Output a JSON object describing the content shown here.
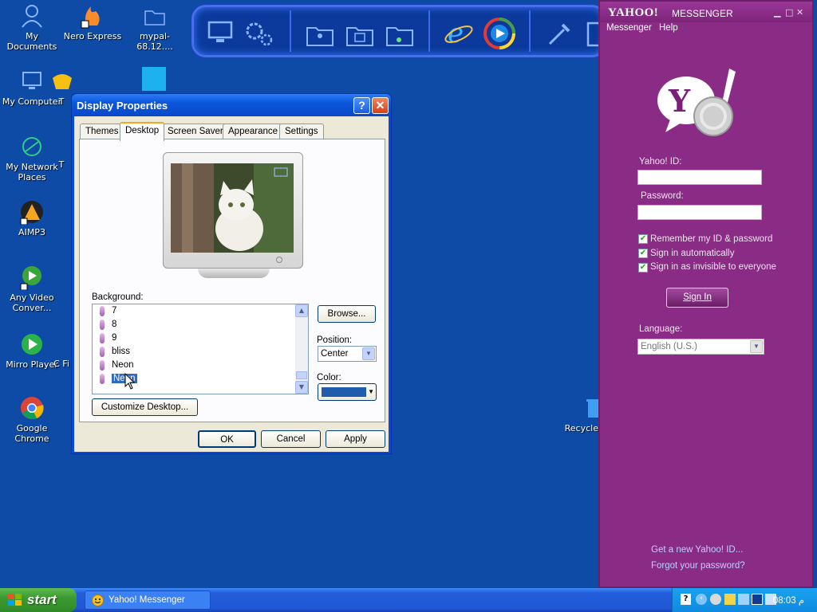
{
  "desktop": {
    "icons": [
      {
        "label": "My Documents"
      },
      {
        "label": "Nero Express"
      },
      {
        "label": "mypal-68.12...."
      },
      {
        "label": "My Computer"
      },
      {
        "label": "T"
      },
      {
        "label": "My Network Places"
      },
      {
        "label": "T"
      },
      {
        "label": "AIMP3"
      },
      {
        "label": "Any Video Conver..."
      },
      {
        "label": "Mirro Player"
      },
      {
        "label": "C Fi"
      },
      {
        "label": "Google Chrome"
      },
      {
        "label": "Recycle"
      }
    ]
  },
  "display_properties": {
    "title": "Display Properties",
    "help_btn": "?",
    "close_btn": "✕",
    "tabs": [
      {
        "label": "Themes"
      },
      {
        "label": "Desktop"
      },
      {
        "label": "Screen Saver"
      },
      {
        "label": "Appearance"
      },
      {
        "label": "Settings"
      }
    ],
    "active_tab": "Desktop",
    "background_label": "Background:",
    "background_items": [
      "7",
      "8",
      "9",
      "bliss",
      "Neon",
      "Neon"
    ],
    "selected_background": "Neon",
    "browse_btn": "Browse...",
    "position_label": "Position:",
    "position_value": "Center",
    "color_label": "Color:",
    "color_value": "#1f5cad",
    "customize_btn": "Customize Desktop...",
    "ok_btn": "OK",
    "cancel_btn": "Cancel",
    "apply_btn": "Apply"
  },
  "yahoo": {
    "brand": "YAHOO!",
    "app_name": "MESSENGER",
    "menu": {
      "messenger": "Messenger",
      "help": "Help"
    },
    "id_label": "Yahoo! ID:",
    "password_label": "Password:",
    "remember_label": "Remember my ID & password",
    "auto_label": "Sign in automatically",
    "invisible_label": "Sign in as invisible to everyone",
    "signin_btn": "Sign In",
    "language_label": "Language:",
    "language_value": "English (U.S.)",
    "new_id_link": "Get a new Yahoo! ID...",
    "forgot_link": "Forgot your password?"
  },
  "taskbar": {
    "start_label": "start",
    "task_item": "Yahoo! Messenger",
    "clock": "08:03 م"
  },
  "colors": {
    "desktop": "#0e4ba6",
    "yahoo_purple": "#8a2b86",
    "xp_blue": "#0a4ad6"
  }
}
